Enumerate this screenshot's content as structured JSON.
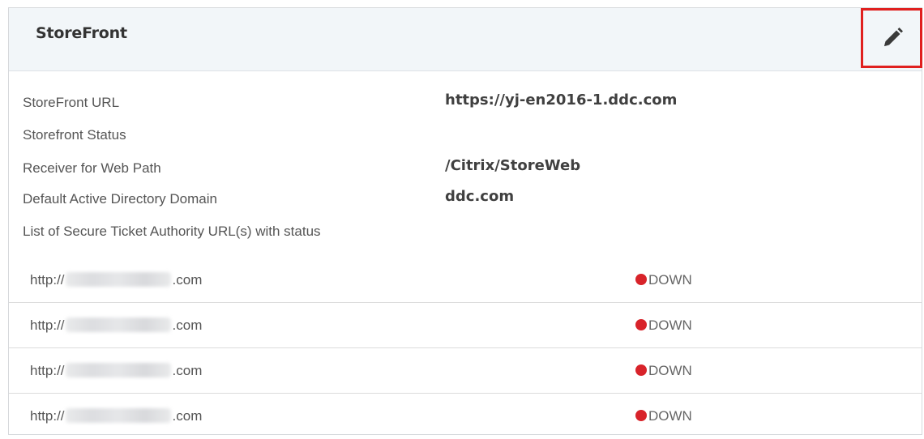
{
  "panel": {
    "title": "StoreFront",
    "edit_icon": "pencil-icon"
  },
  "info": [
    {
      "label": "StoreFront URL",
      "value": "https://yj-en2016-1.ddc.com"
    },
    {
      "label": "Storefront Status",
      "value": ""
    },
    {
      "label": "Receiver for Web Path",
      "value": "/Citrix/StoreWeb"
    },
    {
      "label": "Default Active Directory Domain",
      "value": "ddc.com"
    },
    {
      "label": "List of Secure Ticket Authority URL(s) with status",
      "value": ""
    }
  ],
  "sta": [
    {
      "prefix": "http://",
      "suffix": ".com",
      "status": "DOWN"
    },
    {
      "prefix": "http://",
      "suffix": ".com",
      "status": "DOWN"
    },
    {
      "prefix": "http://",
      "suffix": ".com",
      "status": "DOWN"
    },
    {
      "prefix": "http://",
      "suffix": ".com",
      "status": "DOWN"
    }
  ],
  "colors": {
    "status_down": "#d8232a",
    "highlight": "#e0201f",
    "header_bg": "#f2f6f9"
  }
}
